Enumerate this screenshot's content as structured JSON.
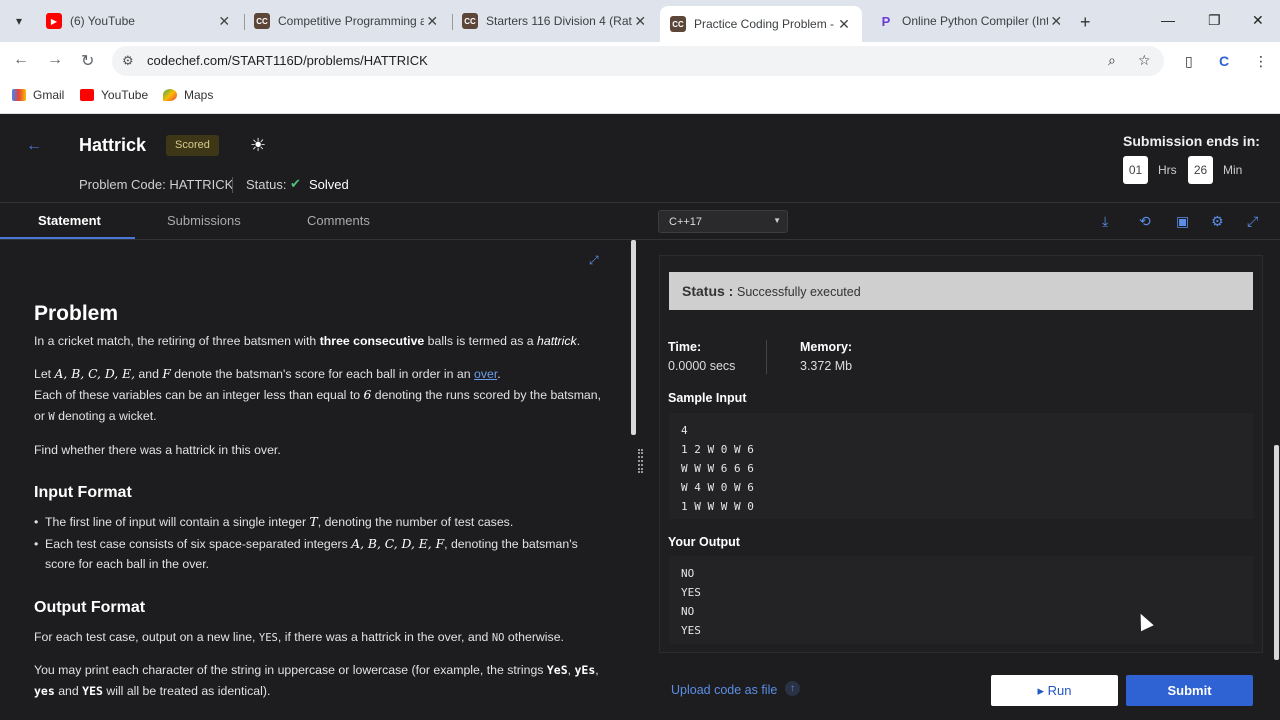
{
  "browser": {
    "tabs": [
      {
        "title": "(6) YouTube",
        "fav": "youtube",
        "color": "#ff0000"
      },
      {
        "title": "Competitive Programming a",
        "fav": "codechef",
        "color": "#5b4638"
      },
      {
        "title": "Starters 116 Division 4 (Rate",
        "fav": "codechef",
        "color": "#5b4638"
      },
      {
        "title": "Practice Coding Problem - C",
        "fav": "codechef",
        "color": "#5b4638"
      },
      {
        "title": "Online Python Compiler (Int",
        "fav": "python",
        "color": "#6a3bd6"
      }
    ],
    "active_tab": 3,
    "url": "codechef.com/START116D/problems/HATTRICK",
    "bookmarks": [
      "Gmail",
      "YouTube",
      "Maps"
    ]
  },
  "problem": {
    "title": "Hattrick",
    "badge": "Scored",
    "code_label": "Problem Code: HATTRICK",
    "status_label": "Status:",
    "status_value": "Solved"
  },
  "timer": {
    "label": "Submission ends in:",
    "hours": "01",
    "hours_unit": "Hrs",
    "minutes": "26",
    "minutes_unit": "Min"
  },
  "tabs": [
    "Statement",
    "Submissions",
    "Comments"
  ],
  "language": "C++17",
  "statement": {
    "h_problem": "Problem",
    "p1_a": "In a cricket match, the retiring of three batsmen with ",
    "p1_b": "three consecutive",
    "p1_c": " balls is termed as a ",
    "p1_d": "hattrick",
    "p1_e": ".",
    "p2_a": "Let ",
    "p2_vars": "A, B, C, D, E,",
    "p2_and": " and ",
    "p2_f": "F",
    "p2_b": " denote the batsman's score for each ball in order in an ",
    "p2_link": "over",
    "p2_c": ".",
    "p3_a": "Each of these variables can be an integer less than equal to ",
    "p3_six": "6",
    "p3_b": " denoting the runs scored by the batsman, or ",
    "p3_w": "W",
    "p3_c": " denoting a wicket.",
    "p4": "Find whether there was a hattrick in this over.",
    "h_input": "Input Format",
    "in1_a": "The first line of input will contain a single integer ",
    "in1_t": "T",
    "in1_b": ", denoting the number of test cases.",
    "in2_a": "Each test case consists of six space-separated integers ",
    "in2_vars": "A, B, C, D, E, F",
    "in2_b": ", denoting the batsman's score for each ball in the over.",
    "h_output": "Output Format",
    "out1_a": "For each test case, output on a new line, ",
    "out1_yes": "YES",
    "out1_b": ", if there was a hattrick in the over, and ",
    "out1_no": "NO",
    "out1_c": " otherwise.",
    "out2_a": "You may print each character of the string in uppercase or lowercase (for example, the strings ",
    "out2_s1": "YeS",
    "out2_s2": "yEs",
    "out2_s3": "yes",
    "out2_and": " and ",
    "out2_s4": "YES",
    "out2_b": " will all be treated as identical)."
  },
  "result": {
    "status_key": "Status :",
    "status_val": "Successfully executed",
    "time_label": "Time:",
    "time_val": "0.0000 secs",
    "memory_label": "Memory:",
    "memory_val": "3.372 Mb",
    "sample_input_label": "Sample Input",
    "sample_input": "4\n1 2 W 0 W 6\nW W W 6 6 6\nW 4 W 0 W 6\n1 W W W W 0",
    "your_output_label": "Your Output",
    "your_output": "NO\nYES\nNO\nYES"
  },
  "footer": {
    "upload": "Upload code as file",
    "run": "Run",
    "submit": "Submit"
  }
}
